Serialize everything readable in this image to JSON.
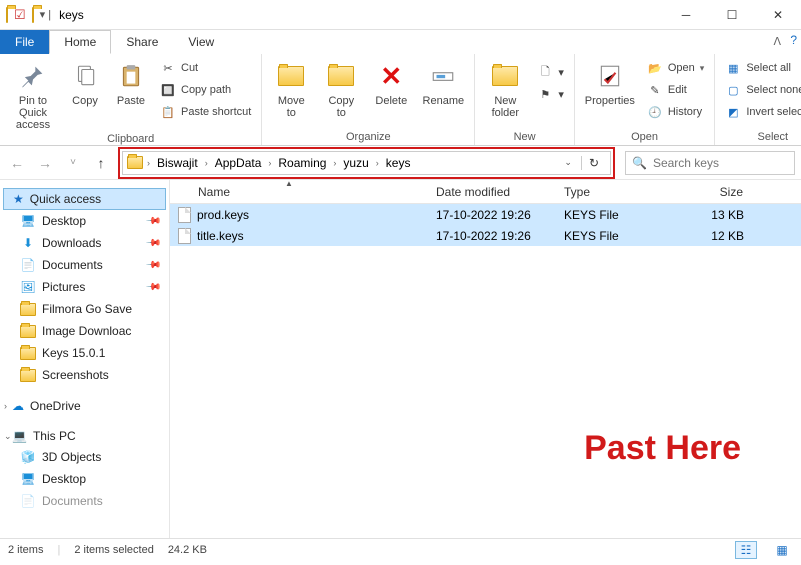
{
  "window": {
    "title": "keys"
  },
  "tabs": {
    "file": "File",
    "home": "Home",
    "share": "Share",
    "view": "View"
  },
  "ribbon": {
    "clipboard": {
      "label": "Clipboard",
      "pin": "Pin to Quick\naccess",
      "copy": "Copy",
      "paste": "Paste",
      "cut": "Cut",
      "copy_path": "Copy path",
      "paste_shortcut": "Paste shortcut"
    },
    "organize": {
      "label": "Organize",
      "move_to": "Move\nto",
      "copy_to": "Copy\nto",
      "delete": "Delete",
      "rename": "Rename"
    },
    "new": {
      "label": "New",
      "new_folder": "New\nfolder"
    },
    "open": {
      "label": "Open",
      "properties": "Properties",
      "open": "Open",
      "edit": "Edit",
      "history": "History"
    },
    "select": {
      "label": "Select",
      "select_all": "Select all",
      "select_none": "Select none",
      "invert": "Invert selection"
    }
  },
  "breadcrumb": [
    "Biswajit",
    "AppData",
    "Roaming",
    "yuzu",
    "keys"
  ],
  "search": {
    "placeholder": "Search keys"
  },
  "sidebar": {
    "quick_access": "Quick access",
    "items": [
      {
        "label": "Desktop",
        "pinned": true,
        "icon": "desktop"
      },
      {
        "label": "Downloads",
        "pinned": true,
        "icon": "downloads"
      },
      {
        "label": "Documents",
        "pinned": true,
        "icon": "documents"
      },
      {
        "label": "Pictures",
        "pinned": true,
        "icon": "pictures"
      },
      {
        "label": "Filmora Go Save",
        "pinned": false,
        "icon": "folder"
      },
      {
        "label": "Image Downloac",
        "pinned": false,
        "icon": "folder"
      },
      {
        "label": "Keys 15.0.1",
        "pinned": false,
        "icon": "folder"
      },
      {
        "label": "Screenshots",
        "pinned": false,
        "icon": "folder"
      }
    ],
    "onedrive": "OneDrive",
    "this_pc": "This PC",
    "pc_items": [
      {
        "label": "3D Objects",
        "icon": "3d"
      },
      {
        "label": "Desktop",
        "icon": "desktop"
      },
      {
        "label": "Documents",
        "icon": "documents"
      }
    ]
  },
  "columns": {
    "name": "Name",
    "date": "Date modified",
    "type": "Type",
    "size": "Size"
  },
  "files": [
    {
      "name": "prod.keys",
      "date": "17-10-2022 19:26",
      "type": "KEYS File",
      "size": "13 KB"
    },
    {
      "name": "title.keys",
      "date": "17-10-2022 19:26",
      "type": "KEYS File",
      "size": "12 KB"
    }
  ],
  "status": {
    "items": "2 items",
    "selected": "2 items selected",
    "size": "24.2 KB"
  },
  "annotation": "Past Here"
}
